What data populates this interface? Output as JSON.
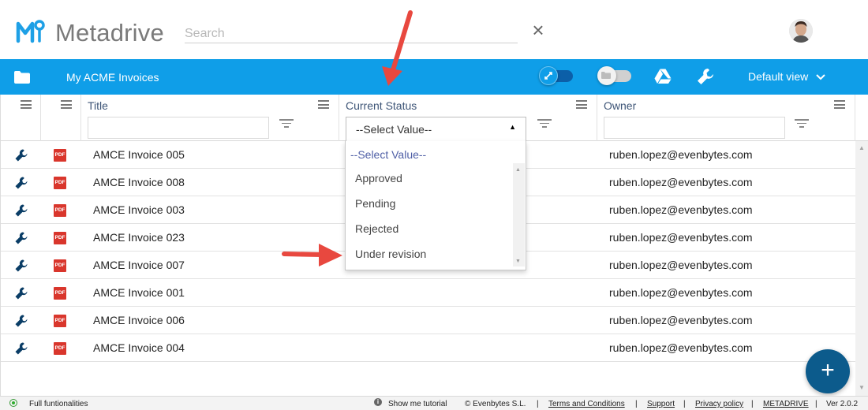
{
  "app": {
    "brand": "Metadrive",
    "search_placeholder": "Search",
    "search_clear": "×"
  },
  "toolbar": {
    "title": "My ACME Invoices",
    "view_label": "Default view",
    "view_chevron": "⌄"
  },
  "grid": {
    "columns": {
      "title": "Title",
      "status": "Current Status",
      "owner": "Owner"
    },
    "status_filter_value": "--Select Value--",
    "status_filter_caret": "▲",
    "rows": [
      {
        "file_type": "PDF",
        "title": "AMCE Invoice 005",
        "owner": "ruben.lopez@evenbytes.com"
      },
      {
        "file_type": "PDF",
        "title": "AMCE Invoice 008",
        "owner": "ruben.lopez@evenbytes.com"
      },
      {
        "file_type": "PDF",
        "title": "AMCE Invoice 003",
        "owner": "ruben.lopez@evenbytes.com"
      },
      {
        "file_type": "PDF",
        "title": "AMCE Invoice 023",
        "owner": "ruben.lopez@evenbytes.com"
      },
      {
        "file_type": "PDF",
        "title": "AMCE Invoice 007",
        "owner": "ruben.lopez@evenbytes.com"
      },
      {
        "file_type": "PDF",
        "title": "AMCE Invoice 001",
        "owner": "ruben.lopez@evenbytes.com"
      },
      {
        "file_type": "PDF",
        "title": "AMCE Invoice 006",
        "owner": "ruben.lopez@evenbytes.com"
      },
      {
        "file_type": "PDF",
        "title": "AMCE Invoice 004",
        "owner": "ruben.lopez@evenbytes.com"
      }
    ]
  },
  "dropdown": {
    "options": [
      "--Select Value--",
      "Approved",
      "Pending",
      "Rejected",
      "Under revision"
    ],
    "selected_index": 0
  },
  "fab": {
    "label": "+"
  },
  "footer": {
    "mode": "Full funtionalities",
    "tutorial": "Show me tutorial",
    "copyright": "© Evenbytes S.L.",
    "terms": "Terms and Conditions",
    "support": "Support",
    "privacy": "Privacy policy",
    "metadrive": "METADRIVE",
    "version": "Ver 2.0.2",
    "separator": "|"
  },
  "colors": {
    "toolbar": "#0f9ee8",
    "fab": "#0c5b8c",
    "pdf_badge": "#d9362c",
    "annotation_arrow": "#e8483f"
  },
  "icons": {
    "folder": "folder-icon",
    "toggle_compact": "compress-icon",
    "toggle_folder": "folder-toggle-icon",
    "drive": "google-drive-icon",
    "settings": "wrench-icon",
    "row_action": "wrench-icon",
    "file": "pdf-icon",
    "column_menu": "hamburger-menu-icon",
    "filter": "filter-icon",
    "info": "info-icon"
  }
}
